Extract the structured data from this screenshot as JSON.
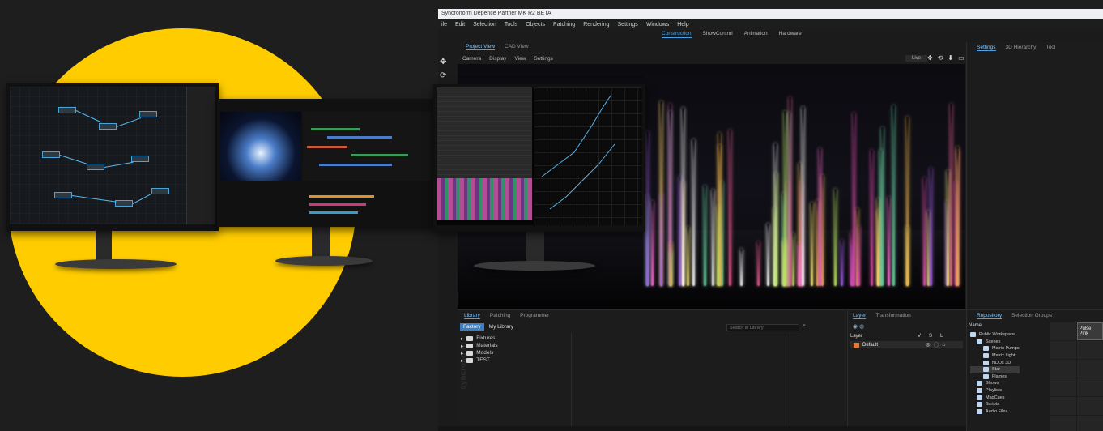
{
  "app": {
    "title": "Syncronorm Depence Partner MK R2 BETA",
    "menu": [
      "ile",
      "Edit",
      "Selection",
      "Tools",
      "Objects",
      "Patching",
      "Rendering",
      "Settings",
      "Windows",
      "Help"
    ],
    "modes": [
      "Construction",
      "ShowControl",
      "Animation",
      "Hardware"
    ],
    "active_mode": "Construction"
  },
  "project_view": {
    "tabs": [
      "Project View",
      "CAD View"
    ],
    "view_menu": [
      "Camera",
      "Display",
      "View",
      "Settings"
    ],
    "live_label": "Live"
  },
  "settings_panel": {
    "tabs": [
      "Settings",
      "3D Hierarchy",
      "Tool"
    ]
  },
  "library": {
    "tabs": [
      "Library",
      "Patching",
      "Programmer"
    ],
    "sources": [
      "Factory",
      "My Library"
    ],
    "search_placeholder": "Search in Library",
    "tree": [
      "Fixtures",
      "Materials",
      "Models",
      "TEST"
    ]
  },
  "layer": {
    "tabs": [
      "Layer",
      "Transformation"
    ],
    "columns": {
      "layer": "Layer",
      "v": "V",
      "s": "S",
      "l": "L"
    },
    "rows": [
      {
        "name": "Default"
      }
    ]
  },
  "repository": {
    "tabs": [
      "Repository",
      "Selection Groups"
    ],
    "column": "Name",
    "tree": [
      {
        "label": "Public Workspace",
        "level": 0
      },
      {
        "label": "Scenes",
        "level": 1
      },
      {
        "label": "Matrix Pumps",
        "level": 2
      },
      {
        "label": "Matrix Light",
        "level": 2
      },
      {
        "label": "NDDs 3D",
        "level": 2
      },
      {
        "label": "Star",
        "level": 2,
        "selected": true
      },
      {
        "label": "Flames",
        "level": 2
      },
      {
        "label": "Shows",
        "level": 1
      },
      {
        "label": "Playlists",
        "level": 1
      },
      {
        "label": "MagCues",
        "level": 1
      },
      {
        "label": "Scripts",
        "level": 1
      },
      {
        "label": "Audio Files",
        "level": 1
      }
    ],
    "grid_first": "Pulse Pink"
  },
  "colors": {
    "accent_yellow": "#ffcc00",
    "ui_blue": "#4aa3e8",
    "layer_orange": "#e07a3c"
  }
}
